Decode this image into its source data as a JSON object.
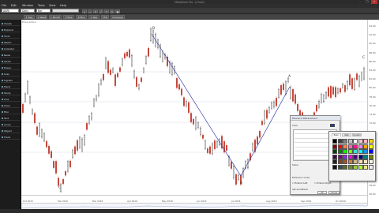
{
  "window": {
    "title": "MetaStock Pro - [Chart]",
    "controls": [
      "-",
      "□",
      "×"
    ]
  },
  "menu": {
    "items": [
      "File",
      "Edit",
      "Window",
      "Tools",
      "View",
      "Help"
    ]
  },
  "toolbar": {
    "symbol_combo": "AAPL",
    "period_combo": "Daily",
    "style_combo": "Bar",
    "range_buttons": [
      "1 Day",
      "1 Week",
      "1 Month",
      "3 Mos",
      "6 Mos",
      "1 Year",
      "YTD",
      "Compare"
    ]
  },
  "sidebar": {
    "items": [
      "Charts",
      "Explorer",
      "Tools",
      "Watch",
      "Indicator",
      "News",
      "Alerts",
      "Power",
      "Scan",
      "Signals",
      "Trend",
      "Study",
      "Line",
      "Chan",
      "Fibo",
      "Text",
      "Arrow",
      "Object",
      "Trade"
    ]
  },
  "chart": {
    "caption": "Price Action",
    "wave_labels": [
      "B",
      "A",
      "C",
      "C",
      "A"
    ],
    "y_ticks": [
      "94.00",
      "92.00",
      "90.00",
      "88.00",
      "86.00",
      "84.00",
      "82.00",
      "80.00",
      "78.00",
      "76.00",
      "74.00",
      "72.00",
      "70.00",
      "68.00",
      "66.00",
      "64.00",
      "62.00",
      "60.00",
      "58.00",
      "56.00"
    ],
    "x_ticks": [
      "Oct 2015",
      "Feb 2016",
      "Mar 2016",
      "Apr 2016",
      "May 2016",
      "Jun 2016",
      "Jul 2016",
      "Aug 2016",
      "Sep 2016",
      "Oct 2016"
    ],
    "up_color": "#1a1a1a",
    "down_color": "#c0392b",
    "zigzag_color": "#3a3fa8"
  },
  "dialog": {
    "title": "Fibonacci Retracement",
    "color_label": "Color",
    "list_rows": [
      "0",
      "23.6",
      "38.2",
      "50",
      "61.8",
      "78.6",
      "100"
    ],
    "show_label": "Show",
    "extension_label": "Extension Lines",
    "extend_left": "Extend Left",
    "extend_right": "Extend Right",
    "default_label": "Set as Default",
    "ok": "OK",
    "cancel": "Cancel"
  },
  "palette": {
    "tabs": [
      "Basic",
      "Web",
      "System"
    ],
    "colors": [
      "#000000",
      "#404040",
      "#7f7f7f",
      "#c0c0c0",
      "#ffffff",
      "#ffc0cb",
      "#ffb6c1",
      "#ffd700",
      "#7f0000",
      "#ff0000",
      "#ff7f50",
      "#ff69b4",
      "#ff1493",
      "#ee82ee",
      "#ffa500",
      "#ffff00",
      "#004000",
      "#008000",
      "#00ff00",
      "#7fff00",
      "#40e0d0",
      "#00ffff",
      "#1e90ff",
      "#0000ff",
      "#400040",
      "#800080",
      "#8a2be2",
      "#ff00ff",
      "#4b0082",
      "#000080",
      "#008080",
      "#808000",
      "#202020",
      "#8b4513",
      "#a0522d",
      "#cd853f",
      "#d2b48c",
      "#f5deb3",
      "#ffe4c4",
      "#fff8dc",
      "#101010",
      "#2f4f4f",
      "#556b2f",
      "#6b8e23",
      "#9acd32",
      "#adff2f",
      "#f0e68c",
      "#eeeeee"
    ]
  }
}
